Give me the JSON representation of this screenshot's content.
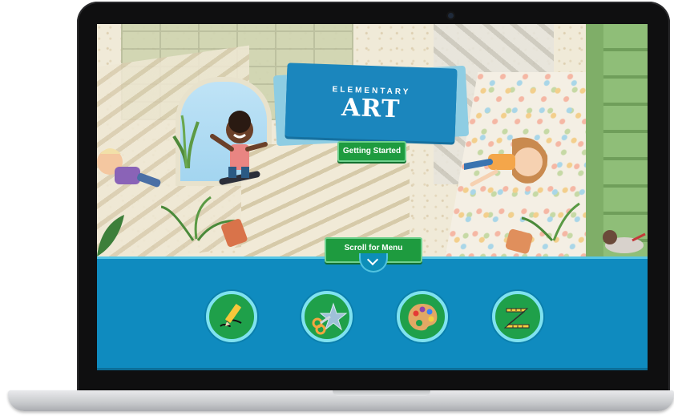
{
  "app": {
    "title_top": "ELEMENTARY",
    "title_main": "ART"
  },
  "buttons": {
    "getting_started": "Getting Started",
    "scroll_menu": "Scroll for Menu"
  },
  "menu": {
    "items": [
      {
        "icon": "pencil-draw-icon"
      },
      {
        "icon": "scissors-star-icon"
      },
      {
        "icon": "palette-icon"
      },
      {
        "icon": "ruler-icon"
      }
    ]
  },
  "colors": {
    "accent_blue": "#1b86bd",
    "menu_band": "#0f8bbf",
    "button_green": "#1e9b3f"
  }
}
